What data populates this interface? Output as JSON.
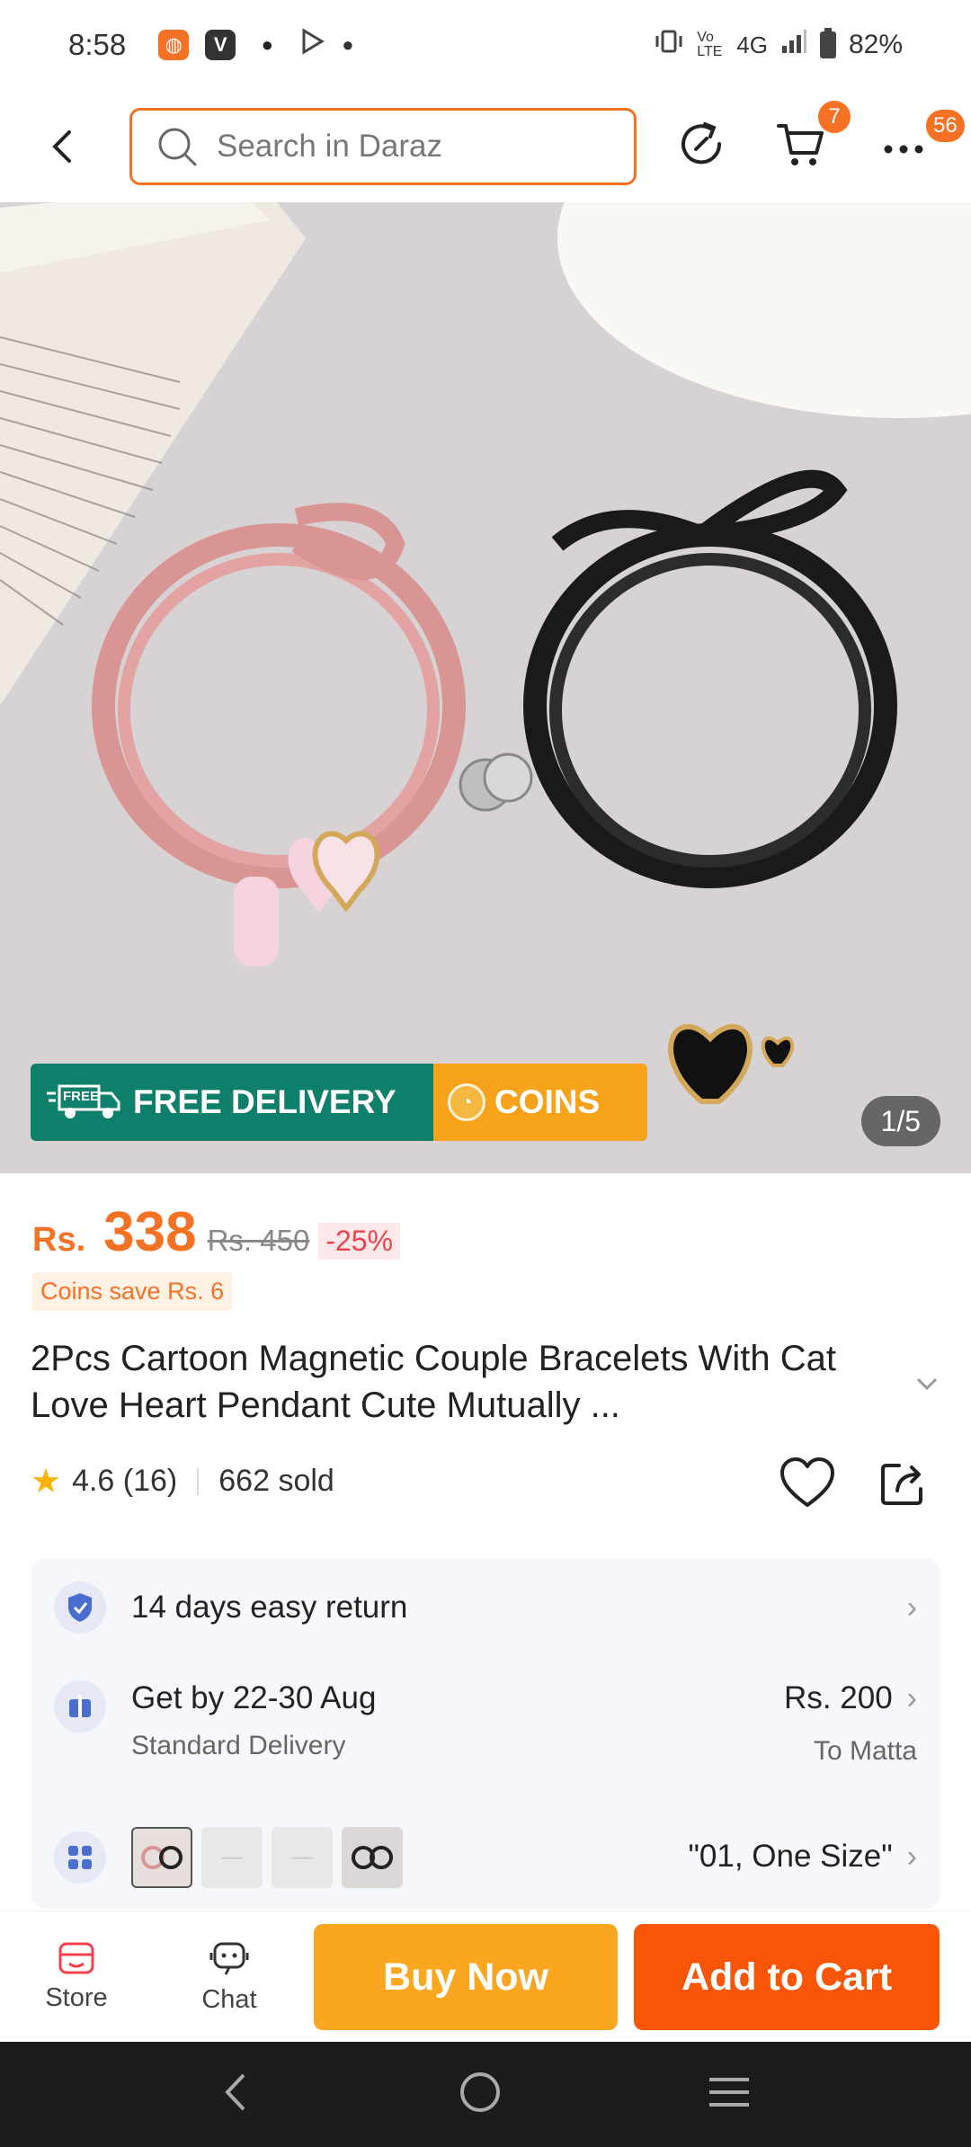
{
  "status_bar": {
    "time": "8:58",
    "network": "4G",
    "volte": "Vo LTE",
    "battery": "82%"
  },
  "header": {
    "search_placeholder": "Search in Daraz",
    "cart_badge": "7",
    "more_badge": "56"
  },
  "hero": {
    "delivery_label": "FREE DELIVERY",
    "free_tag": "FREE",
    "coins_label": "COINS",
    "counter": "1/5"
  },
  "price": {
    "currency": "Rs.",
    "current": "338",
    "original": "Rs. 450",
    "discount": "-25%",
    "coins_save": "Coins save Rs. 6"
  },
  "product": {
    "title": "2Pcs Cartoon Magnetic Couple Bracelets With Cat Love Heart Pendant Cute Mutually ...",
    "rating": "4.6 (16)",
    "sold": "662 sold"
  },
  "info": {
    "return_policy": "14 days easy return",
    "delivery_date": "Get by 22-30 Aug",
    "delivery_type": "Standard Delivery",
    "delivery_fee": "Rs. 200",
    "delivery_to": "To Matta",
    "variant_value": "\"01, One Size\""
  },
  "actions": {
    "store": "Store",
    "chat": "Chat",
    "buy_now": "Buy Now",
    "add_to_cart": "Add to Cart"
  },
  "colors": {
    "accent": "#f57224",
    "buy_now": "#faa71f",
    "add_to_cart": "#f85606",
    "free_delivery": "#0e7f6a",
    "coins": "#f7a21b"
  }
}
